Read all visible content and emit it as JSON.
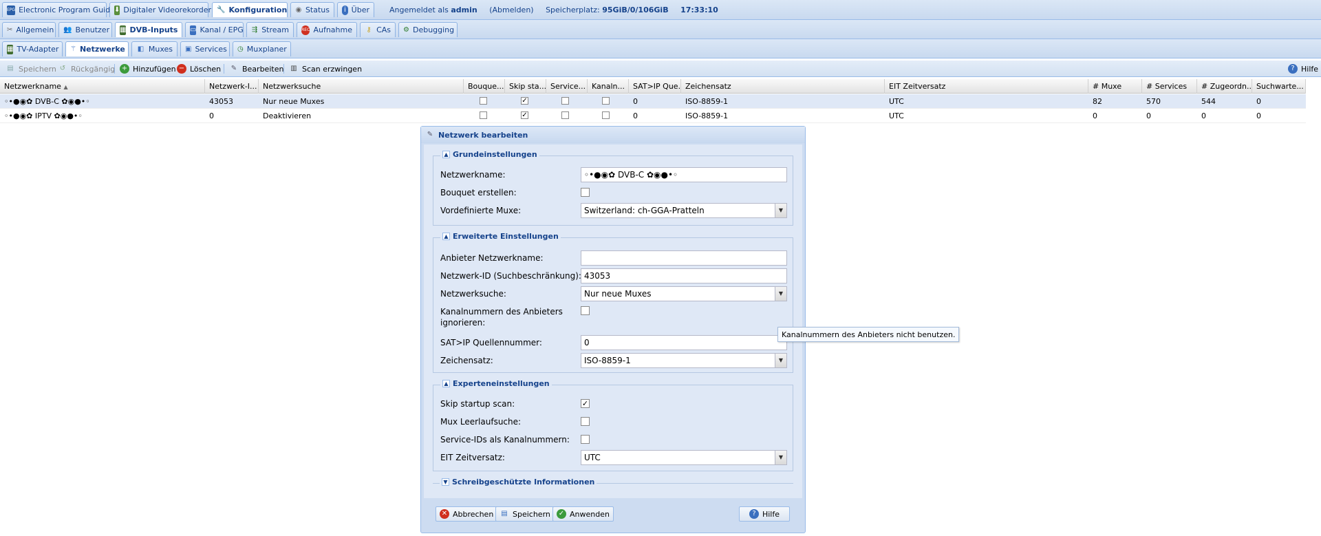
{
  "top_tabs": [
    {
      "label": "Electronic Program Guide",
      "icon": "epg-icon"
    },
    {
      "label": "Digitaler Videorekorder",
      "icon": "dvr-download-icon"
    },
    {
      "label": "Konfiguration",
      "icon": "wrench-icon"
    },
    {
      "label": "Status",
      "icon": "eye-icon"
    },
    {
      "label": "Über",
      "icon": "info-icon"
    }
  ],
  "login": {
    "prefix": "Angemeldet als",
    "user": "admin",
    "logout": "(Abmelden)",
    "storage_label": "Speicherplatz:",
    "storage_value": "95GiB/0/106GiB",
    "time": "17:33:10"
  },
  "config_tabs": [
    {
      "label": "Allgemein"
    },
    {
      "label": "Benutzer"
    },
    {
      "label": "DVB-Inputs"
    },
    {
      "label": "Kanal / EPG"
    },
    {
      "label": "Stream"
    },
    {
      "label": "Aufnahme"
    },
    {
      "label": "CAs"
    },
    {
      "label": "Debugging"
    }
  ],
  "dvb_tabs": [
    {
      "label": "TV-Adapter"
    },
    {
      "label": "Netzwerke"
    },
    {
      "label": "Muxes"
    },
    {
      "label": "Services"
    },
    {
      "label": "Muxplaner"
    }
  ],
  "toolbar": {
    "save": "Speichern",
    "undo": "Rückgängig",
    "add": "Hinzufügen",
    "delete": "Löschen",
    "edit": "Bearbeiten",
    "force_scan": "Scan erzwingen",
    "help": "Hilfe"
  },
  "grid": {
    "columns": [
      "Netzwerkname",
      "Netzwerk-I...",
      "Netzwerksuche",
      "Bouque...",
      "Skip sta...",
      "Service...",
      "Kanaln...",
      "SAT>IP Que...",
      "Zeichensatz",
      "EIT Zeitversatz",
      "# Muxe",
      "# Services",
      "# Zugeordn...",
      "Suchwarte..."
    ],
    "rows": [
      {
        "name": "◦•●◉✿ DVB-C ✿◉●•◦",
        "network_id": "43053",
        "search": "Nur neue Muxes",
        "bouquet": false,
        "skip": true,
        "service": false,
        "kanal": false,
        "satip": "0",
        "charset": "ISO-8859-1",
        "eit": "UTC",
        "muxes": "82",
        "services": "570",
        "assigned": "544",
        "queue": "0"
      },
      {
        "name": "◦•●◉✿ IPTV ✿◉●•◦",
        "network_id": "0",
        "search": "Deaktivieren",
        "bouquet": false,
        "skip": true,
        "service": false,
        "kanal": false,
        "satip": "0",
        "charset": "ISO-8859-1",
        "eit": "UTC",
        "muxes": "0",
        "services": "0",
        "assigned": "0",
        "queue": "0"
      }
    ]
  },
  "dialog": {
    "title": "Netzwerk bearbeiten",
    "sections": {
      "basic": "Grundeinstellungen",
      "advanced": "Erweiterte Einstellungen",
      "expert": "Experteneinstellungen",
      "readonly": "Schreibgeschützte Informationen"
    },
    "fields": {
      "netname_label": "Netzwerkname:",
      "netname_value": "◦•●◉✿ DVB-C ✿◉●•◦",
      "bouquet_label": "Bouquet erstellen:",
      "predef_label": "Vordefinierte Muxe:",
      "predef_value": "Switzerland: ch-GGA-Pratteln",
      "provider_label": "Anbieter Netzwerkname:",
      "provider_value": "",
      "netid_label": "Netzwerk-ID (Suchbeschränkung):",
      "netid_value": "43053",
      "netsearch_label": "Netzwerksuche:",
      "netsearch_value": "Nur neue Muxes",
      "ignore_label_1": "Kanalnummern des Anbieters",
      "ignore_label_2": "ignorieren:",
      "satip_label": "SAT>IP Quellennummer:",
      "satip_value": "0",
      "charset_label": "Zeichensatz:",
      "charset_value": "ISO-8859-1",
      "skip_label": "Skip startup scan:",
      "idle_label": "Mux Leerlaufsuche:",
      "sid_label": "Service-IDs als Kanalnummern:",
      "eit_label": "EIT Zeitversatz:",
      "eit_value": "UTC"
    },
    "buttons": {
      "cancel": "Abbrechen",
      "save": "Speichern",
      "apply": "Anwenden",
      "help": "Hilfe"
    }
  },
  "tooltip": "Kanalnummern des Anbieters nicht benutzen."
}
